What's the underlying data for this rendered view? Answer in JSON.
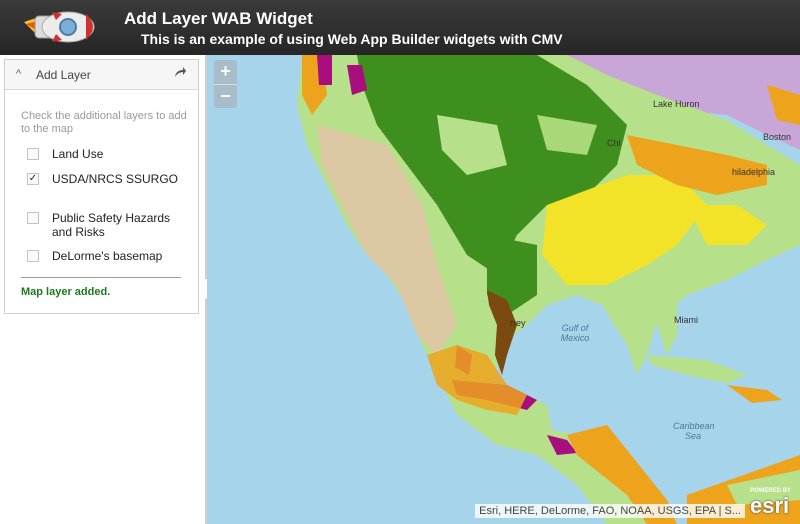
{
  "header": {
    "title": "Add Layer WAB Widget",
    "subtitle": "This is an example of using Web App Builder widgets with CMV"
  },
  "widget": {
    "title": "Add Layer",
    "instructions": "Check the additional layers to add to the map",
    "layers": [
      {
        "label": "Land Use",
        "checked": false
      },
      {
        "label": "USDA/NRCS SSURGO",
        "checked": true
      },
      {
        "label": "Public Safety Hazards and Risks",
        "checked": false
      },
      {
        "label": "DeLorme's basemap",
        "checked": false
      }
    ],
    "status": "Map layer added.",
    "check_mark": "✓"
  },
  "map": {
    "zoom_in": "+",
    "zoom_out": "−",
    "attribution": "Esri, HERE, DeLorme, FAO, NOAA, USGS, EPA | S...",
    "powered_by": "POWERED BY",
    "esri_logo_text": "esri",
    "labels": {
      "lake_huron": "Lake Huron",
      "boston": "Boston",
      "philadelphia": "hiladelphia",
      "chicago": "Chi",
      "gulf_of_mexico": "Gulf of Mexico",
      "caribbean_sea": "Caribbean Sea",
      "monterrey": "rrey",
      "miami": "Miami"
    }
  },
  "colors": {
    "header_bg": "#2b2b2b",
    "status_green": "#1d7a1d",
    "ocean": "#a6d4ea",
    "forest_green": "#3f8f1f",
    "light_green": "#b6e08a",
    "tan": "#dcc9a4",
    "yellow": "#f2e228",
    "orange": "#eea31c",
    "magenta": "#a80e7d",
    "brown": "#7a4a10",
    "lavender": "#c9a6d8"
  }
}
